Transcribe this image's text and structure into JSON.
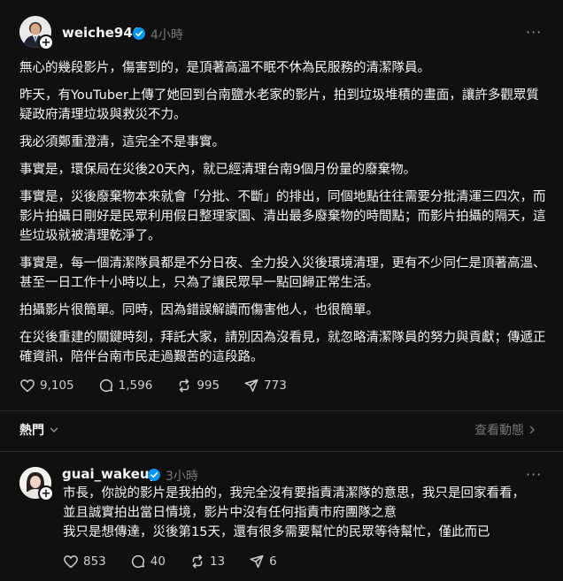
{
  "post": {
    "username": "weiche946",
    "time": "4小時",
    "paragraphs": [
      "無心的幾段影片，傷害到的，是頂著高溫不眠不休為民服務的清潔隊員。",
      "昨天，有YouTuber上傳了她回到台南鹽水老家的影片，拍到垃圾堆積的畫面，讓許多觀眾質疑政府清理垃圾與救災不力。",
      "我必須鄭重澄清，這完全不是事實。",
      "事實是，環保局在災後20天內，就已經清理台南9個月份量的廢棄物。",
      "事實是，災後廢棄物本來就會「分批、不斷」的排出，同個地點往往需要分批清運三四次，而影片拍攝日剛好是民眾利用假日整理家園、清出最多廢棄物的時間點；而影片拍攝的隔天，這些垃圾就被清理乾淨了。",
      "事實是，每一個清潔隊員都是不分日夜、全力投入災後環境清理，更有不少同仁是頂著高溫、甚至一日工作十小時以上，只為了讓民眾早一點回歸正常生活。",
      "拍攝影片很簡單。同時，因為錯誤解讀而傷害他人，也很簡單。",
      "在災後重建的關鍵時刻，拜託大家，請別因為沒看見，就忽略清潔隊員的努力與貢獻；傳遞正確資訊，陪伴台南市民走過艱苦的這段路。"
    ],
    "likes": "9,105",
    "comments": "1,596",
    "reposts": "995",
    "shares": "773"
  },
  "sort_bar": {
    "sort_label": "熱門",
    "view_activity": "查看動態"
  },
  "reply": {
    "username": "guai_wakeup",
    "time": "3小時",
    "lines": [
      "市長，你說的影片是我拍的，我完全沒有要指責清潔隊的意思，我只是回家看看，",
      "並且誠實拍出當日情境，影片中沒有任何指責市府團隊之意",
      "我只是想傳達，災後第15天，還有很多需要幫忙的民眾等待幫忙，僅此而已"
    ],
    "likes": "853",
    "comments": "40",
    "reposts": "13",
    "shares": "6"
  },
  "icons": {
    "more": "more-horizontal-icon",
    "verified": "verified-badge-icon",
    "like": "heart-icon",
    "comment": "comment-bubble-icon",
    "repost": "repost-icon",
    "share": "send-icon",
    "chevron": "chevron-down-icon",
    "arrow": "chevron-right-icon",
    "follow": "plus-icon"
  },
  "colors": {
    "background": "#101010",
    "text": "#f3f5f7",
    "muted": "#777777",
    "verified": "#0095f6"
  }
}
